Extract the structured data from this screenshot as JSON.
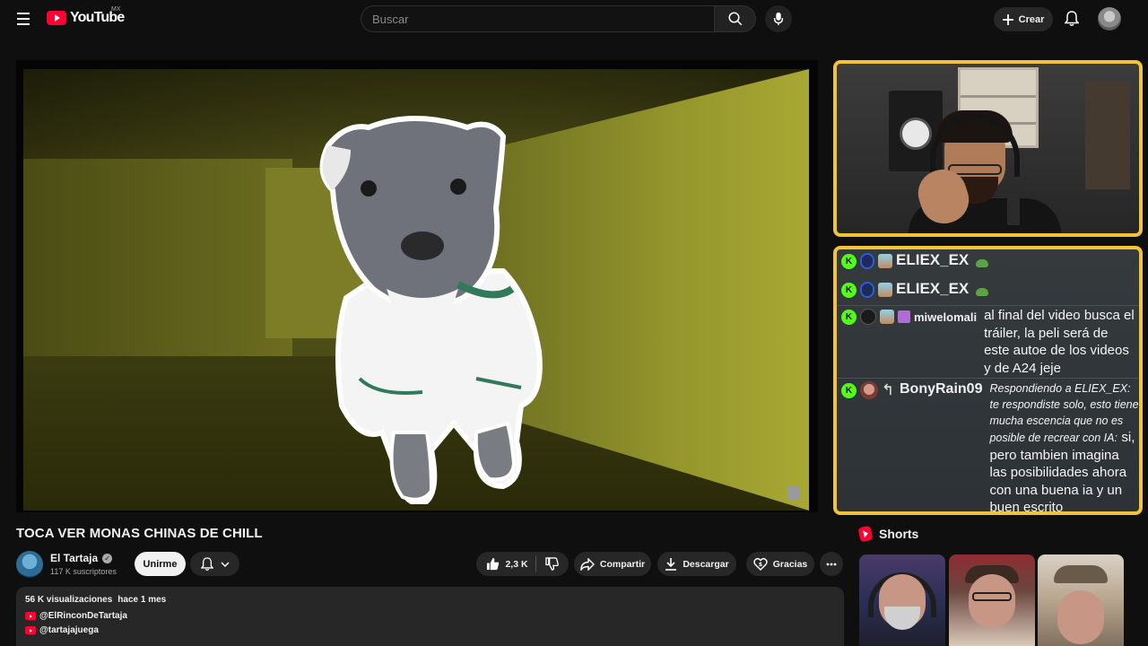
{
  "header": {
    "logo_text": "YouTube",
    "country_code": "MX",
    "search_placeholder": "Buscar",
    "create_label": "Crear"
  },
  "video": {
    "title": "TOCA VER MONAS CHINAS DE CHILL"
  },
  "channel": {
    "name": "El Tartaja",
    "subscribers": "117 K suscriptores",
    "join_label": "Unirme"
  },
  "actions": {
    "likes": "2,3 K",
    "share_label": "Compartir",
    "download_label": "Descargar",
    "thanks_label": "Gracias"
  },
  "description": {
    "views": "56 K visualizaciones",
    "date": "hace 1 mes",
    "links": [
      "@ElRinconDeTartaja",
      "@tartajajuega"
    ]
  },
  "chat": {
    "messages": [
      {
        "user": "ELIEX_EX",
        "text": ""
      },
      {
        "user": "ELIEX_EX",
        "text": ""
      },
      {
        "user": "miwelomali",
        "text": "al final del video busca el tráiler, la peli será de este autoe de los videos y de A24 jeje"
      },
      {
        "user": "BonyRain09",
        "reply_to": "Respondiendo a ELIEX_EX: te respondiste solo, esto tiene mucha escencia que no es posible de recrear con IA:",
        "text": "si, pero tambien imagina las posibilidades ahora con una buena ia y un buen escrito"
      }
    ]
  },
  "shorts": {
    "title": "Shorts"
  },
  "colors": {
    "brand_red": "#ff0033",
    "overlay_border": "#f0c338",
    "kick_green": "#53fc18"
  }
}
